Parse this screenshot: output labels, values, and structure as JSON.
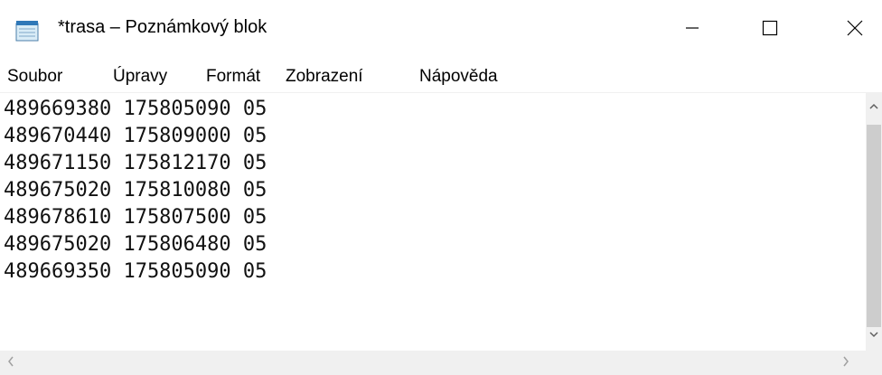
{
  "window": {
    "title": "*trasa – Poznámkový blok",
    "icon": "notepad-icon"
  },
  "controls": {
    "minimize_icon": "minimize-icon",
    "maximize_icon": "maximize-icon",
    "close_icon": "close-icon"
  },
  "menu": {
    "items": [
      "Soubor",
      "Úpravy",
      "Formát",
      "Zobrazení",
      "Nápověda"
    ]
  },
  "editor": {
    "lines": [
      "489669380 175805090 05",
      "489670440 175809000 05",
      "489671150 175812170 05",
      "489675020 175810080 05",
      "489678610 175807500 05",
      "489675020 175806480 05",
      "489669350 175805090 05"
    ]
  },
  "scrollbars": {
    "vertical": {
      "up_icon": "chevron-up-icon",
      "down_icon": "chevron-down-icon"
    },
    "horizontal": {
      "left_icon": "chevron-left-icon",
      "right_icon": "chevron-right-icon"
    }
  }
}
